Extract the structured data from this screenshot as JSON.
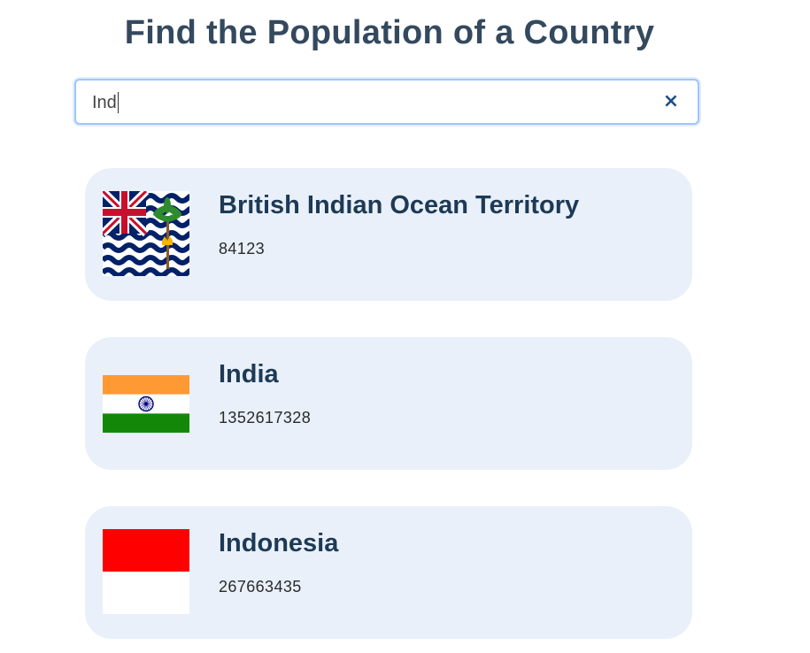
{
  "header": {
    "title": "Find the Population of a Country"
  },
  "search": {
    "value": "Ind",
    "placeholder": "",
    "clear_label": "×"
  },
  "results": [
    {
      "name": "British Indian Ocean Territory",
      "population": "84123",
      "flag": "british-indian-ocean-territory-flag-icon"
    },
    {
      "name": "India",
      "population": "1352617328",
      "flag": "india-flag-icon"
    },
    {
      "name": "Indonesia",
      "population": "267663435",
      "flag": "indonesia-flag-icon"
    }
  ],
  "colors": {
    "title": "#34495e",
    "card_bg": "#e9f0fa",
    "name": "#1d3a55",
    "search_border": "#9ec5fe",
    "clear_icon": "#1f4e89"
  }
}
